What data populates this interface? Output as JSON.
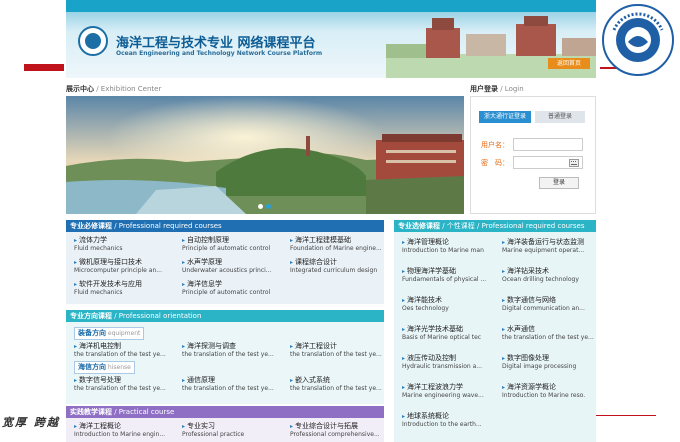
{
  "slide": {
    "footer_text": "宽厚 跨越"
  },
  "banner": {
    "title": "海洋工程与技术专业 网络课程平台",
    "subtitle": "Ocean Engineering and Technology Network Course Platform",
    "home_button": "返回首页"
  },
  "showcase": {
    "heading": "展示中心",
    "heading_en": " / Exhibition Center"
  },
  "login": {
    "heading": "用户登录",
    "heading_en": " / Login",
    "tab1": "浙大通行证登录",
    "tab2": "普通登录",
    "username_label": "用户名：",
    "password_label": "密　码：",
    "submit": "登录"
  },
  "required": {
    "title": "专业必修课程",
    "title_en": " / Professional required courses",
    "items": [
      {
        "zh": "流体力学",
        "en": "Fluid mechanics"
      },
      {
        "zh": "自动控制原理",
        "en": "Principle of automatic control"
      },
      {
        "zh": "海洋工程建模基础",
        "en": "Foundation of Marine engine..."
      },
      {
        "zh": "微机原理与接口技术",
        "en": "Microcomputer principle an..."
      },
      {
        "zh": "水声学原理",
        "en": "Underwater acoustics princi..."
      },
      {
        "zh": "课程综合设计",
        "en": "Integrated curriculum design"
      },
      {
        "zh": "软件开发技术与应用",
        "en": "Fluid mechanics"
      },
      {
        "zh": "海洋信息学",
        "en": "Principle of automatic control"
      }
    ]
  },
  "orientation": {
    "title": "专业方向课程",
    "title_en": " / Professional orientation",
    "group1": "装备方向",
    "group1_en": " equipment",
    "group2": "海信方向",
    "group2_en": " hisense",
    "items1": [
      {
        "zh": "海洋机电控制",
        "en": "the translation of the test ye..."
      },
      {
        "zh": "海洋探测与调查",
        "en": "the translation of the test ye..."
      },
      {
        "zh": "海洋工程设计",
        "en": "the translation of the test ye..."
      }
    ],
    "items2": [
      {
        "zh": "数字信号处理",
        "en": "the translation of the test ye..."
      },
      {
        "zh": "通信原理",
        "en": "the translation of the test ye..."
      },
      {
        "zh": "嵌入式系统",
        "en": "the translation of the test ye..."
      }
    ]
  },
  "practical": {
    "title": "实践教学课程",
    "title_en": " / Practical course",
    "items": [
      {
        "zh": "海洋工程概论",
        "en": "Introduction to Marine engin..."
      },
      {
        "zh": "专业实习",
        "en": "Professional practice"
      },
      {
        "zh": "专业综合设计与拓展",
        "en": "Professional comprehensive..."
      }
    ]
  },
  "elective": {
    "title": "专业选修课程",
    "title_en": " / 个性课程 / Professional required courses",
    "items": [
      {
        "zh": "海洋管理概论",
        "en": "Introduction to Marine man"
      },
      {
        "zh": "海洋装备运行与状态监测",
        "en": "Marine equipment operat..."
      },
      {
        "zh": "物理海洋学基础",
        "en": "Fundamentals of physical ..."
      },
      {
        "zh": "海洋钻采技术",
        "en": "Ocean drilling technology"
      },
      {
        "zh": "海洋能技术",
        "en": "Oes technology"
      },
      {
        "zh": "数字通信与网络",
        "en": "Digital communication an..."
      },
      {
        "zh": "海洋光学技术基础",
        "en": "Basis of Marine optical tec"
      },
      {
        "zh": "水声通信",
        "en": "the translation of the test ye..."
      },
      {
        "zh": "液压传动及控制",
        "en": "Hydraulic transmission a..."
      },
      {
        "zh": "数字图像处理",
        "en": "Digital image processing"
      },
      {
        "zh": "海洋工程波浪力学",
        "en": "Marine engineering wave..."
      },
      {
        "zh": "海洋资源学概论",
        "en": "Introduction to Marine reso."
      },
      {
        "zh": "地球系统概论",
        "en": "Introduction to the earth..."
      }
    ]
  },
  "colors": {
    "blue_header": "#1f6fb2",
    "teal_header": "#2bb3c6",
    "purple_header": "#8f6fc4",
    "accent_orange": "#e56b16",
    "slide_red": "#c0121b"
  }
}
